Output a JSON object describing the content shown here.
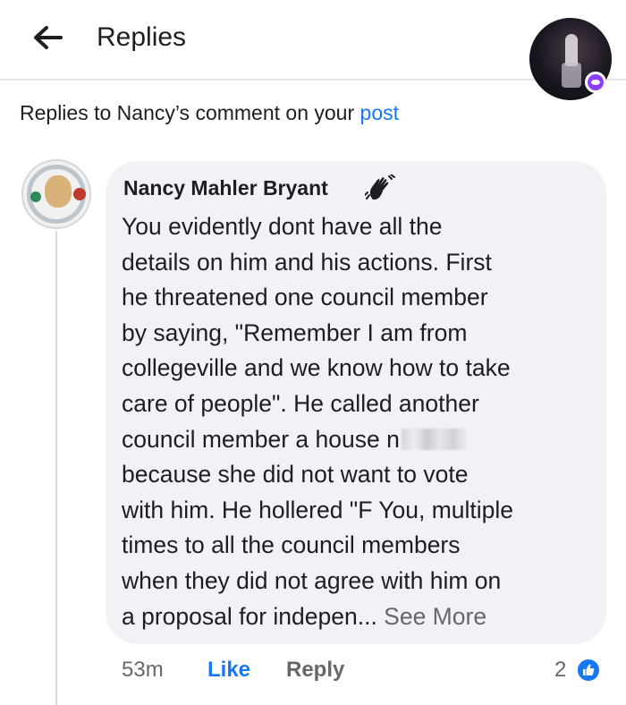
{
  "header": {
    "title": "Replies",
    "back_icon": "arrow-left-icon"
  },
  "subtitle": {
    "text": "Replies to Nancy’s comment on your ",
    "link": "post"
  },
  "comment": {
    "author": "Nancy Mahler Bryant",
    "author_badge_icon": "wave-hand-icon",
    "lines": [
      "You evidently dont have all the",
      "details on him and his actions. First",
      "he threatened one council member",
      "by saying, \"Remember I am from",
      "collegeville and we know how to take",
      "care of people\". He called another",
      "council member a house n",
      "because she did  not want to vote",
      "with him. He hollered \"F You, multiple",
      "times to all the council members",
      "when they did not agree with him on",
      "a proposal for indepen... "
    ],
    "see_more": "See More",
    "time": "53m",
    "like_label": "Like",
    "reply_label": "Reply",
    "reaction_count": "2",
    "reaction_icon": "like-reaction-icon"
  },
  "colors": {
    "link_blue": "#1877f2",
    "bubble_bg": "#f0f2f5",
    "muted_text": "#65676b",
    "messenger_purple": "#8a3ffc"
  }
}
